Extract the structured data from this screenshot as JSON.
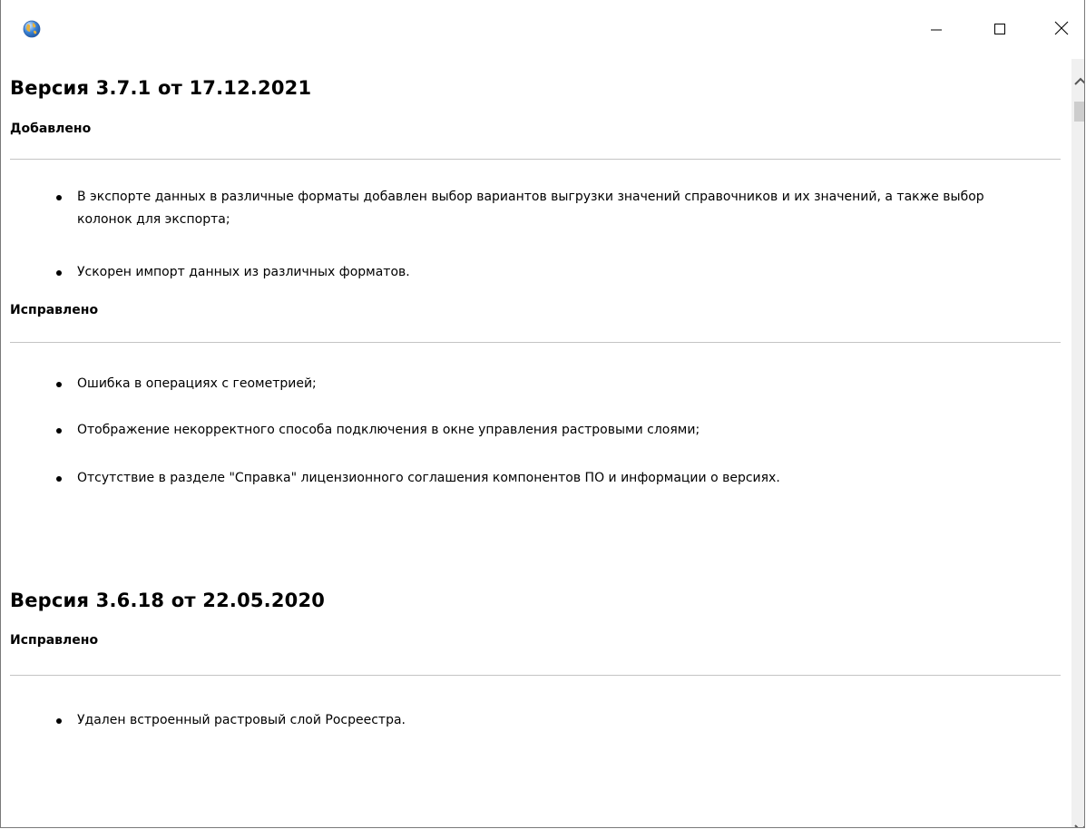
{
  "window": {
    "icon": "globe-icon",
    "controls": {
      "minimize": "minimize-icon",
      "maximize": "maximize-icon",
      "close": "close-icon"
    }
  },
  "releases": [
    {
      "title": "Версия 3.7.1 от 17.12.2021",
      "sections": [
        {
          "heading": "Добавлено",
          "items": [
            "В экспорте данных в различные форматы добавлен выбор вариантов выгрузки значений справочников и их значений, а также выбор колонок для экспорта;",
            "Ускорен импорт данных из различных форматов."
          ]
        },
        {
          "heading": "Исправлено",
          "items": [
            "Ошибка в операциях с геометрией;",
            "Отображение некорректного способа подключения в окне управления растровыми слоями;",
            "Отсутствие в разделе \"Справка\" лицензионного соглашения компонентов ПО и информации о версиях."
          ]
        }
      ]
    },
    {
      "title": "Версия 3.6.18 от 22.05.2020",
      "sections": [
        {
          "heading": "Исправлено",
          "items": [
            "Удален встроенный растровый слой Росреестра."
          ]
        }
      ]
    }
  ],
  "colors": {
    "background": "#ffffff",
    "text": "#000000",
    "divider": "#c4c4c4",
    "scrollbar_track": "#f0f0f0",
    "scrollbar_thumb": "#cdcdcd"
  }
}
